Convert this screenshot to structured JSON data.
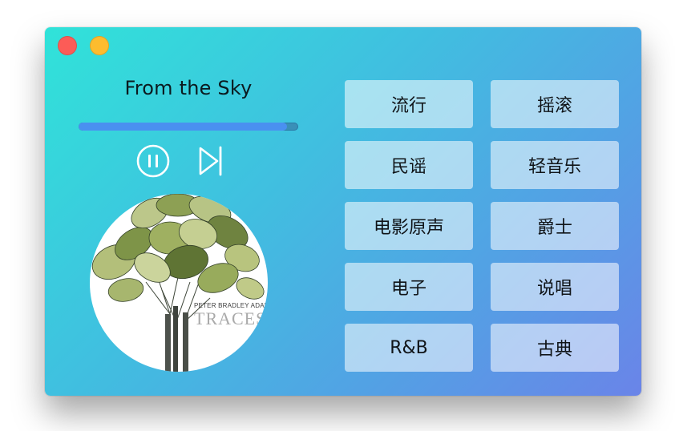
{
  "window": {
    "buttons": [
      "close",
      "minimize"
    ]
  },
  "player": {
    "song_title": "From the Sky",
    "progress_fraction": 0.95,
    "controls": {
      "pause_icon": "pause-icon",
      "next_icon": "skip-next-icon"
    },
    "album": {
      "artist": "PETER BRADLEY ADAMS",
      "title": "TRACES"
    }
  },
  "genres": [
    {
      "label": "流行"
    },
    {
      "label": "摇滚"
    },
    {
      "label": "民谣"
    },
    {
      "label": "轻音乐"
    },
    {
      "label": "电影原声"
    },
    {
      "label": "爵士"
    },
    {
      "label": "电子"
    },
    {
      "label": "说唱"
    },
    {
      "label": "R&B"
    },
    {
      "label": "古典"
    }
  ],
  "colors": {
    "close": "#fc5c57",
    "minimize": "#fdbc2e",
    "progress_fill": "#4a90f0",
    "gradient_start": "#30e3d9",
    "gradient_end": "#6a84e8"
  }
}
